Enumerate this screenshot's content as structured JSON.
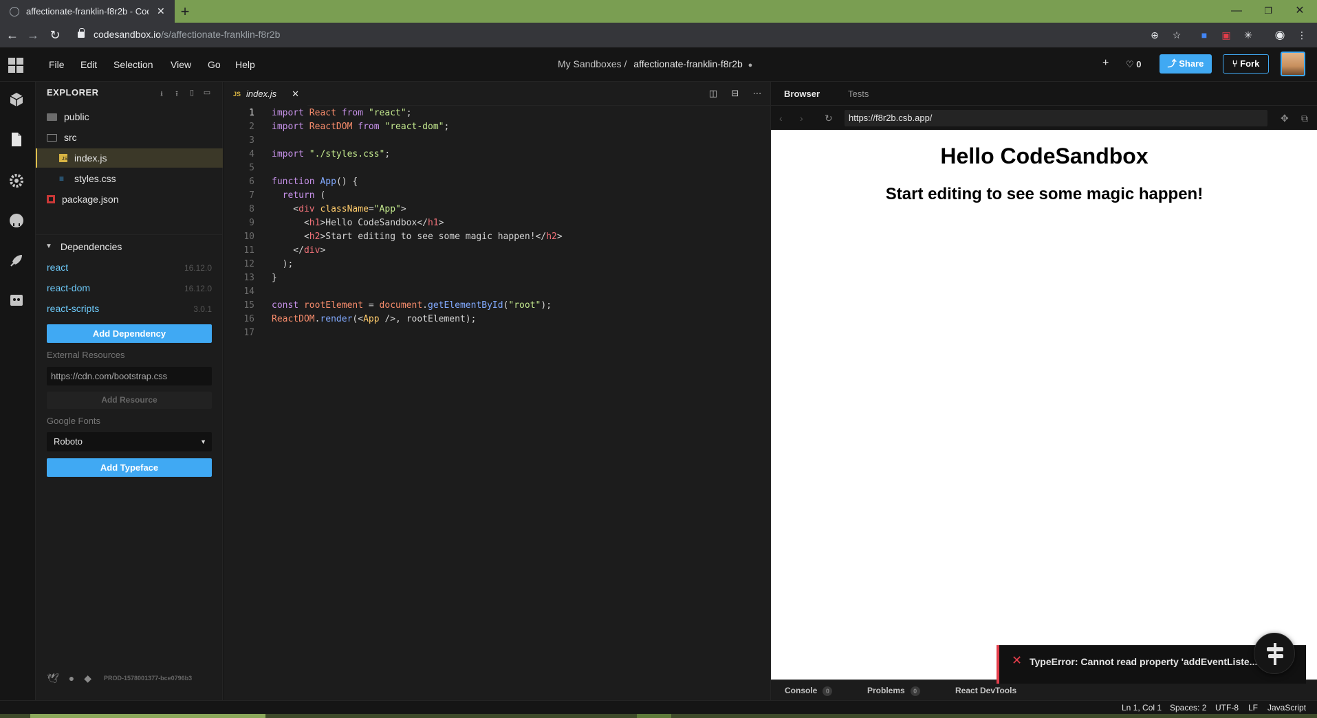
{
  "browser": {
    "tab_title": "affectionate-franklin-f8r2b - Cod",
    "url_host": "codesandbox.io",
    "url_path": "/s/affectionate-franklin-f8r2b"
  },
  "menu": {
    "items": [
      "File",
      "Edit",
      "Selection",
      "View",
      "Go",
      "Help"
    ]
  },
  "header": {
    "breadcrumb_parent": "My Sandboxes /",
    "sandbox_name": "affectionate-franklin-f8r2b",
    "likes": "0",
    "share_label": "Share",
    "fork_label": "Fork"
  },
  "sidebar": {
    "title": "EXPLORER",
    "files": [
      {
        "name": "public",
        "type": "folder"
      },
      {
        "name": "src",
        "type": "folder-open"
      },
      {
        "name": "index.js",
        "type": "js"
      },
      {
        "name": "styles.css",
        "type": "css"
      },
      {
        "name": "package.json",
        "type": "pkg"
      }
    ],
    "dependencies_title": "Dependencies",
    "dependencies": [
      {
        "name": "react",
        "version": "16.12.0"
      },
      {
        "name": "react-dom",
        "version": "16.12.0"
      },
      {
        "name": "react-scripts",
        "version": "3.0.1"
      }
    ],
    "add_dependency_label": "Add Dependency",
    "external_resources_label": "External Resources",
    "external_resources_placeholder": "https://cdn.com/bootstrap.css",
    "add_resource_label": "Add Resource",
    "google_fonts_label": "Google Fonts",
    "font_selected": "Roboto",
    "add_typeface_label": "Add Typeface",
    "build_id": "PROD-1578001377-bce0796b3"
  },
  "editor": {
    "tab_file": "index.js",
    "tab_lang": "JS",
    "lines": [
      "import React from \"react\";",
      "import ReactDOM from \"react-dom\";",
      "",
      "import \"./styles.css\";",
      "",
      "function App() {",
      "  return (",
      "    <div className=\"App\">",
      "      <h1>Hello CodeSandbox</h1>",
      "      <h2>Start editing to see some magic happen!</h2>",
      "    </div>",
      "  );",
      "}",
      "",
      "const rootElement = document.getElementById(\"root\");",
      "ReactDOM.render(<App />, rootElement);",
      ""
    ]
  },
  "preview": {
    "tabs": [
      "Browser",
      "Tests"
    ],
    "url": "https://f8r2b.csb.app/",
    "h1": "Hello CodeSandbox",
    "h2": "Start editing to see some magic happen!",
    "bottom_tabs": [
      {
        "label": "Console",
        "count": "0"
      },
      {
        "label": "Problems",
        "count": "0"
      },
      {
        "label": "React DevTools",
        "count": ""
      }
    ],
    "error": "TypeError: Cannot read property 'addEventListe... of null"
  },
  "statusbar": {
    "position": "Ln 1, Col 1",
    "spaces": "Spaces: 2",
    "encoding": "UTF-8",
    "eol": "LF",
    "language": "JavaScript"
  },
  "colors": {
    "accent": "#40a9f3",
    "tabbar": "#7a9e52",
    "error": "#e33d4a"
  }
}
